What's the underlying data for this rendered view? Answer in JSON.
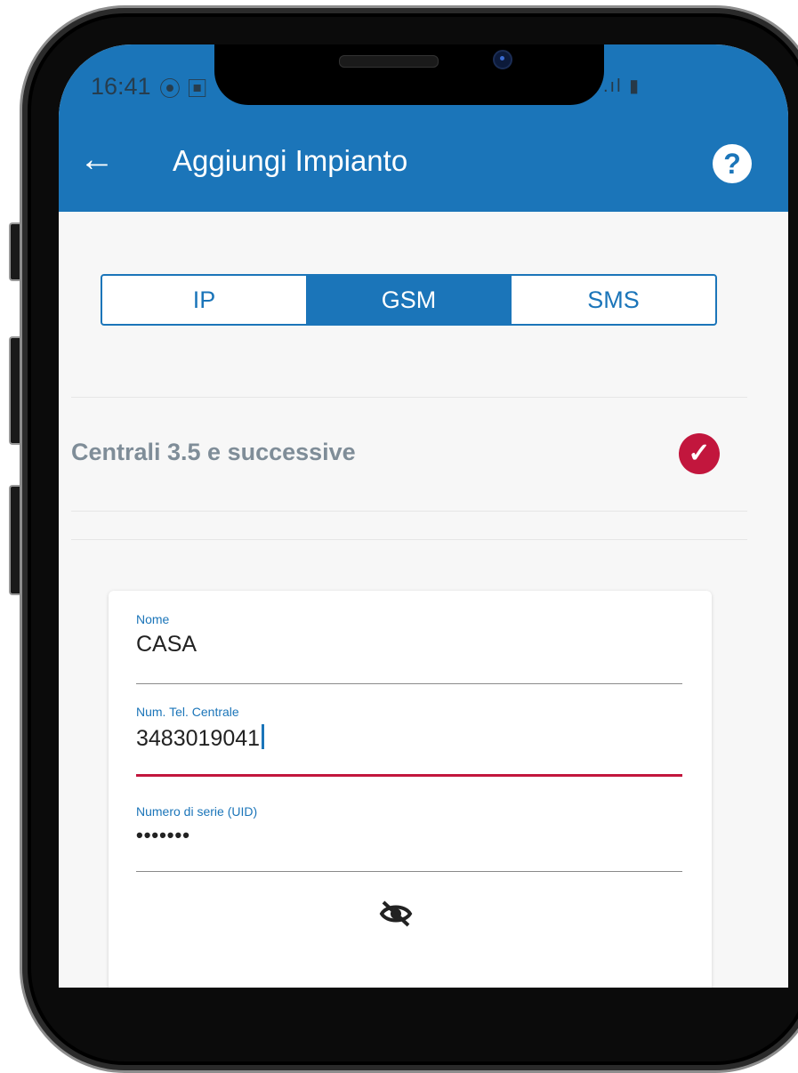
{
  "status_bar": {
    "time": "16:41",
    "left_icons": "⦿ ▣",
    "right_icons": ".ıl ▮"
  },
  "app_bar": {
    "back_icon": "←",
    "title": "Aggiungi Impianto",
    "help_icon": "?"
  },
  "connection_tabs": {
    "items": [
      "IP",
      "GSM",
      "SMS"
    ],
    "selected": "GSM"
  },
  "section": {
    "title": "Centrali 3.5 e successive",
    "check_icon": "✓"
  },
  "form": {
    "name": {
      "label": "Nome",
      "value": "CASA"
    },
    "phone": {
      "label": "Num. Tel. Centrale",
      "value": "3483019041"
    },
    "serial": {
      "label": "Numero di serie (UID)",
      "value": "•••••••"
    }
  },
  "colors": {
    "primary": "#1b75b9",
    "accent": "#c2163d",
    "background": "#f7f7f7"
  }
}
